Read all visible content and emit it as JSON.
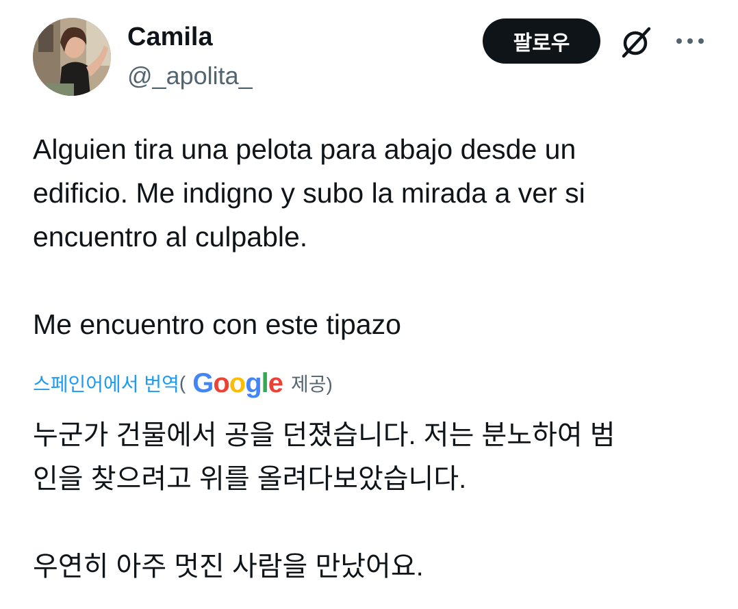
{
  "user": {
    "display_name": "Camila",
    "handle": "@_apolita_"
  },
  "actions": {
    "follow_label": "팔로우",
    "grok_icon": "grok-icon",
    "more_icon": "more-icon"
  },
  "tweet": {
    "text": "Alguien tira una pelota para abajo desde un\nedificio. Me indigno y subo la mirada a ver si\nencuentro al culpable.\n\nMe encuentro con este tipazo",
    "translate_link": "스페인어에서 번역",
    "paren_open": "(",
    "google_letters": [
      "G",
      "o",
      "o",
      "g",
      "l",
      "e"
    ],
    "provided_by": "제공)",
    "translated_text": "누군가 건물에서 공을 던졌습니다. 저는 분노하여 범\n인을 찾으려고 위를 올려다보았습니다.\n\n우연히 아주 멋진 사람을 만났어요."
  },
  "colors": {
    "text": "#0f1419",
    "secondary": "#536471",
    "link": "#1d9bf0",
    "button_bg": "#0f1419",
    "google_blue": "#4285f4",
    "google_red": "#ea4335",
    "google_yellow": "#fbbc05",
    "google_green": "#34a853"
  }
}
